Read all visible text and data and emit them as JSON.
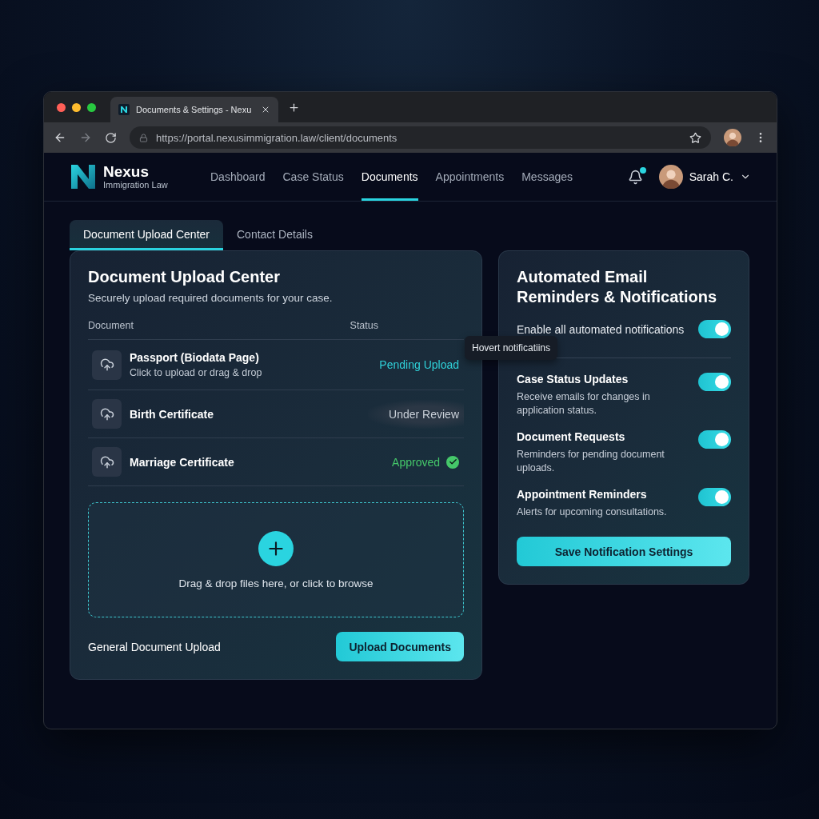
{
  "browser": {
    "tab_title": "Documents & Settings - Nexu",
    "url": "https://portal.nexusimmigration.law/client/documents"
  },
  "header": {
    "brand": {
      "name": "Nexus",
      "subtitle": "Immigration Law"
    },
    "nav": [
      {
        "label": "Dashboard",
        "selected": false
      },
      {
        "label": "Case Status",
        "selected": false
      },
      {
        "label": "Documents",
        "selected": true
      },
      {
        "label": "Appointments",
        "selected": false
      },
      {
        "label": "Messages",
        "selected": false
      }
    ],
    "notifications_unread": true,
    "user": {
      "name": "Sarah C."
    }
  },
  "tabs": [
    {
      "label": "Document Upload Center",
      "selected": true
    },
    {
      "label": "Contact Details",
      "selected": false
    }
  ],
  "upload_panel": {
    "title": "Document Upload Center",
    "subtitle": "Securely upload required documents for your case.",
    "columns": [
      "Document",
      "Status"
    ],
    "documents": [
      {
        "name": "Passport (Biodata Page)",
        "hint": "Click to upload or drag & drop",
        "status": "Pending Upload",
        "kind": "pending"
      },
      {
        "name": "Birth Certificate",
        "status": "Under Review",
        "kind": "review"
      },
      {
        "name": "Marriage Certificate",
        "status": "Approved",
        "kind": "approved"
      }
    ],
    "dropzone": {
      "text": "Drag & drop files here, or click to browse"
    },
    "footer_label": "General Document Upload",
    "button": "Upload Documents"
  },
  "tooltip": {
    "text": "Hovert notificatiins"
  },
  "notifications_panel": {
    "title": "Automated Email Reminders & Notifications",
    "master": {
      "label": "Enable all automated notifications",
      "on": true
    },
    "items": [
      {
        "title": "Case Status Updates",
        "description": "Receive emails for changes in application status.",
        "on": true
      },
      {
        "title": "Document Requests",
        "description": "Reminders for pending document uploads.",
        "on": true
      },
      {
        "title": "Appointment Reminders",
        "description": "Alerts for upcoming consultations.",
        "on": true
      }
    ],
    "button": "Save Notification Settings"
  }
}
